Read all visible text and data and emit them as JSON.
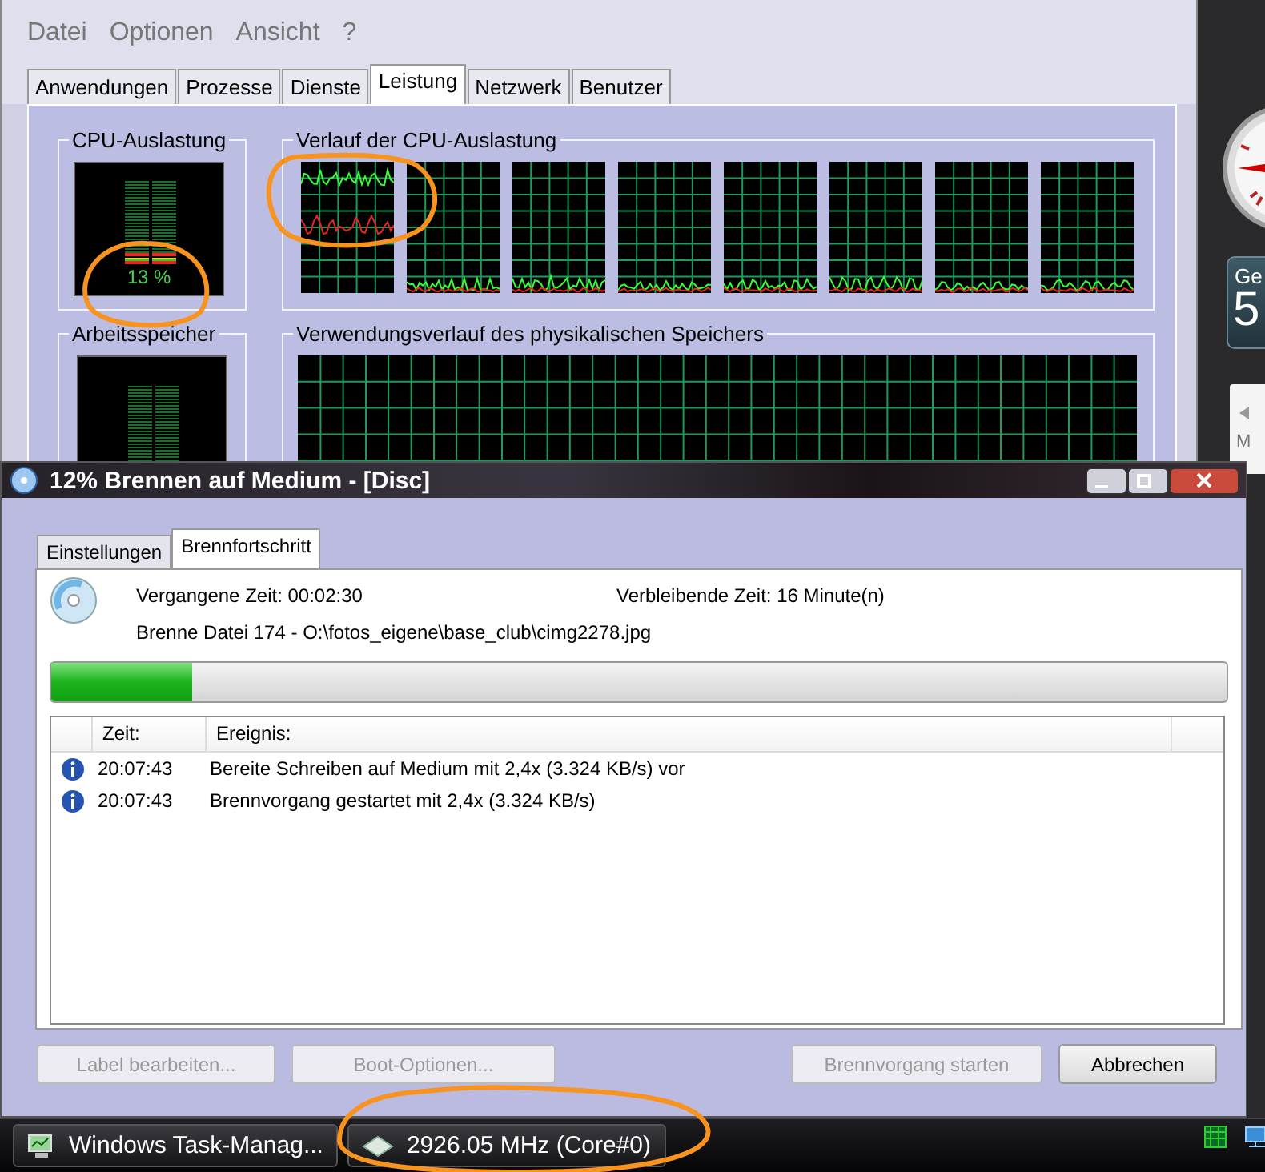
{
  "task_manager": {
    "menu": [
      "Datei",
      "Optionen",
      "Ansicht",
      "?"
    ],
    "tabs": [
      {
        "label": "Anwendungen",
        "selected": false
      },
      {
        "label": "Prozesse",
        "selected": false
      },
      {
        "label": "Dienste",
        "selected": false
      },
      {
        "label": "Leistung",
        "selected": true
      },
      {
        "label": "Netzwerk",
        "selected": false
      },
      {
        "label": "Benutzer",
        "selected": false
      }
    ],
    "cpu_usage": {
      "title": "CPU-Auslastung",
      "reading": "13 %",
      "level": 0.13
    },
    "cpu_history": {
      "title": "Verlauf der CPU-Auslastung"
    },
    "memory": {
      "title": "Arbeitsspeicher"
    },
    "memory_history": {
      "title": "Verwendungsverlauf des physikalischen Speichers"
    }
  },
  "burn_dialog": {
    "title": "12% Brennen auf Medium - [Disc]",
    "tabs": [
      {
        "label": "Einstellungen",
        "selected": false
      },
      {
        "label": "Brennfortschritt",
        "selected": true
      }
    ],
    "elapsed": "Vergangene Zeit: 00:02:30",
    "remaining": "Verbleibende Zeit: 16 Minute(n)",
    "current_file": "Brenne Datei 174 - O:\\fotos_eigene\\base_club\\cimg2278.jpg",
    "progress": {
      "level": 0.12
    },
    "log": {
      "columns": [
        "Zeit:",
        "Ereignis:"
      ],
      "rows": [
        {
          "time": "20:07:43",
          "event": "Bereite Schreiben auf Medium mit 2,4x (3.324 KB/s) vor"
        },
        {
          "time": "20:07:43",
          "event": "Brennvorgang gestartet mit 2,4x (3.324 KB/s)"
        }
      ]
    },
    "buttons": [
      {
        "label": "Label bearbeiten...",
        "disabled": true
      },
      {
        "label": "Boot-Optionen...",
        "disabled": true
      },
      {
        "label": "Brennvorgang starten",
        "disabled": true
      },
      {
        "label": "Abbrechen",
        "disabled": false
      }
    ]
  },
  "taskbar": {
    "buttons": [
      {
        "label": "Windows Task-Manag...",
        "kind": "monitor"
      },
      {
        "label": "2926.05 MHz (Core#0)",
        "kind": "diamond"
      }
    ]
  },
  "gadgets": {
    "weather_label": "Ge",
    "weather_value": "5",
    "calendar_day": "M"
  }
}
